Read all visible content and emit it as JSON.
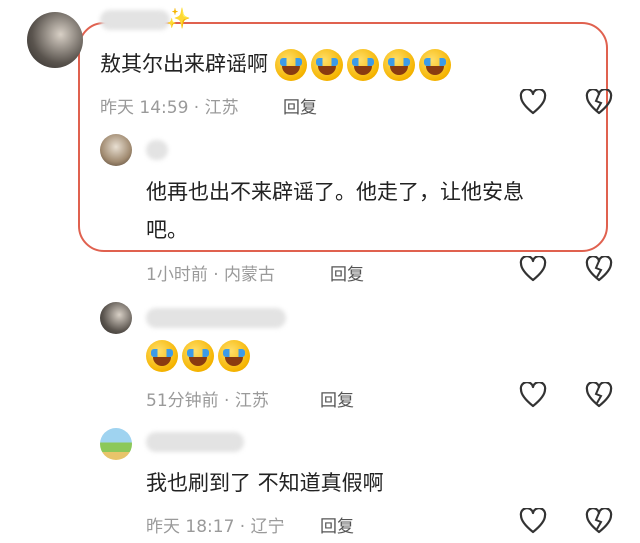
{
  "comments": [
    {
      "text": "敖其尔出来辟谣啊",
      "emoji_count": 5,
      "time_location": "昨天 14:59 · 江苏",
      "reply_label": "回复"
    },
    {
      "text_line1": "他再也出不来辟谣了。他走了，让他安息",
      "text_line2": "吧。",
      "time_location": "1小时前 · 内蒙古",
      "reply_label": "回复"
    },
    {
      "emoji_count": 3,
      "time_location": "51分钟前 · 江苏",
      "reply_label": "回复"
    },
    {
      "text": "我也刷到了 不知道真假啊",
      "time_location": "昨天 18:17 · 辽宁",
      "reply_label": "回复"
    }
  ],
  "icons": {
    "like": "heart-outline-icon",
    "dislike": "broken-heart-icon",
    "sparkle": "sparkle-icon"
  },
  "colors": {
    "highlight_border": "#e0614f",
    "meta_text": "#9a9a9a"
  }
}
